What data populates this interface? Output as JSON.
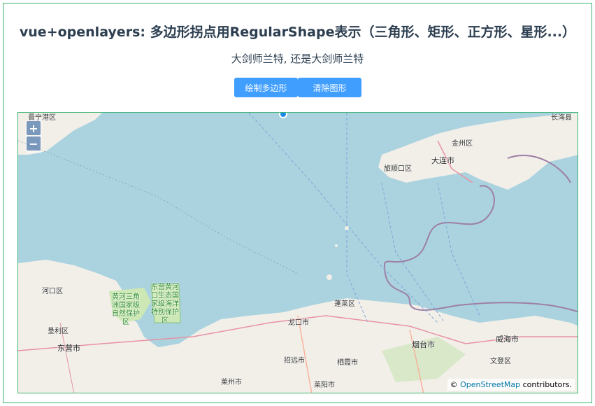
{
  "header": {
    "title": "vue+openlayers: 多边形拐点用RegularShape表示（三角形、矩形、正方形、星形...）",
    "subtitle": "大剑师兰特, 还是大剑师兰特"
  },
  "toolbar": {
    "draw_label": "绘制多边形",
    "clear_label": "清除图形"
  },
  "map": {
    "zoom_in": "+",
    "zoom_out": "−",
    "attribution_prefix": "©",
    "attribution_link": "OpenStreetMap",
    "attribution_suffix": "contributors.",
    "places": {
      "dalian": "大连市",
      "lvshunkou": "旅顺口区",
      "jinzhou": "金州区",
      "hekou": "河口区",
      "kenli": "垦利区",
      "dongying": "东营市",
      "penglai": "蓬莱区",
      "longkou": "龙口市",
      "yantai": "烟台市",
      "weihai": "威海市",
      "zhaoyuan": "招远市",
      "qixia": "栖霞市",
      "laizhou": "莱州市",
      "laiyang": "莱阳市",
      "wendeng": "文登区",
      "park1": "黄河三角洲国家级自然保护区",
      "park2": "东营黄河口生态国家级海洋特别保护区",
      "top_left": "晋宁港区",
      "top_right": "长海县"
    },
    "colors": {
      "sea": "#aad3df",
      "land": "#f2efe9",
      "border": "#9e7fa5",
      "accent": "#409eff"
    }
  }
}
